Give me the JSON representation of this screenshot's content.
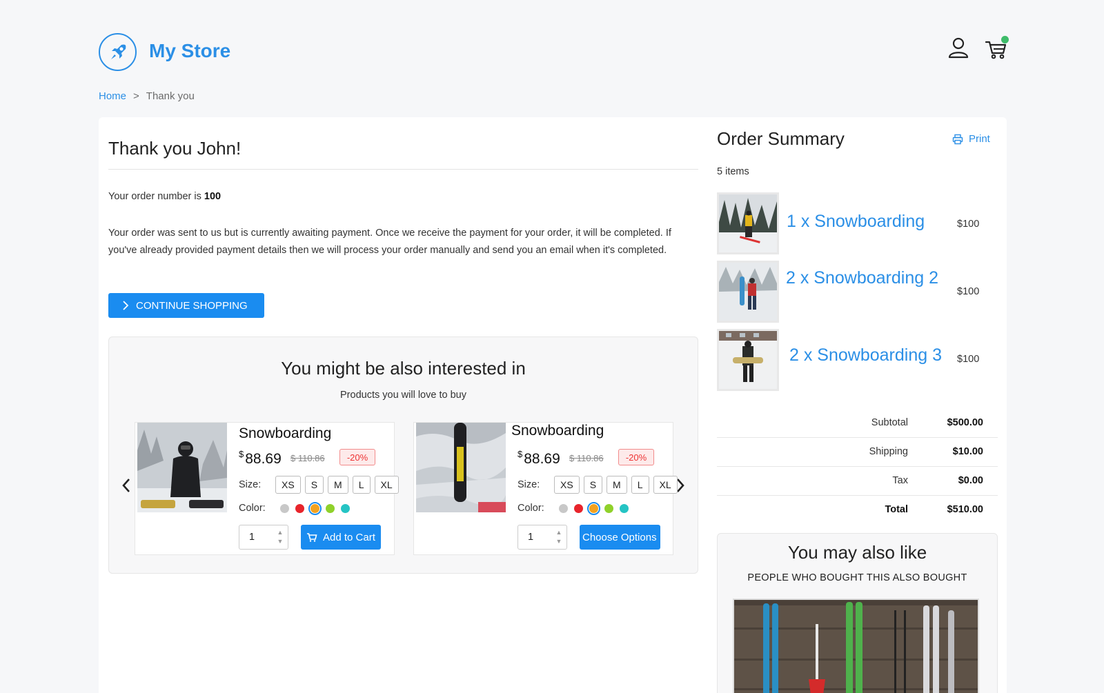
{
  "header": {
    "store_name": "My Store",
    "cart_dot_color": "#3ebc6a"
  },
  "breadcrumb": {
    "home": "Home",
    "separator": ">",
    "current": "Thank you"
  },
  "thankyou": {
    "title": "Thank you John!",
    "order_prefix": "Your order number is",
    "order_number": "100",
    "message": "Your order was sent to us but is currently awaiting payment. Once we receive the payment for your order, it will be completed. If you've already provided payment details then we will process your order manually and send you an email when it's completed.",
    "continue_label": "CONTINUE SHOPPING"
  },
  "interested": {
    "title": "You might be also interested in",
    "subtitle": "Products you will love to buy",
    "products": [
      {
        "name": "Snowboarding",
        "currency": "$",
        "price": "88.69",
        "old_price": "$ 110.86",
        "discount": "-20%",
        "size_label": "Size:",
        "sizes": [
          "XS",
          "S",
          "M",
          "L",
          "XL"
        ],
        "color_label": "Color:",
        "quantity": "1",
        "action_label": "Add to Cart"
      },
      {
        "name": "Snowboarding",
        "currency": "$",
        "price": "88.69",
        "old_price": "$ 110.86",
        "discount": "-20%",
        "size_label": "Size:",
        "sizes": [
          "XS",
          "S",
          "M",
          "L",
          "XL"
        ],
        "color_label": "Color:",
        "quantity": "1",
        "action_label": "Choose Options"
      }
    ],
    "swatch_colors": [
      "#c8c8c8",
      "#e8242b",
      "#f3a21f",
      "#8fd12a",
      "#25c4c4"
    ]
  },
  "summary": {
    "title": "Order Summary",
    "print_label": "Print",
    "items_count": "5 items",
    "items": [
      {
        "name": "1 x Snowboarding",
        "price": "$100"
      },
      {
        "name": "2 x Snowboarding 2",
        "price": "$100"
      },
      {
        "name": "2 x Snowboarding 3",
        "price": "$100"
      }
    ],
    "subtotal_label": "Subtotal",
    "subtotal": "$500.00",
    "shipping_label": "Shipping",
    "shipping": "$10.00",
    "tax_label": "Tax",
    "tax": "$0.00",
    "total_label": "Total",
    "total": "$510.00"
  },
  "also_like": {
    "title": "You may also like",
    "subtitle": "PEOPLE WHO BOUGHT THIS ALSO BOUGHT"
  },
  "colors": {
    "brand": "#2b8fe6",
    "button": "#1a8cf0"
  }
}
